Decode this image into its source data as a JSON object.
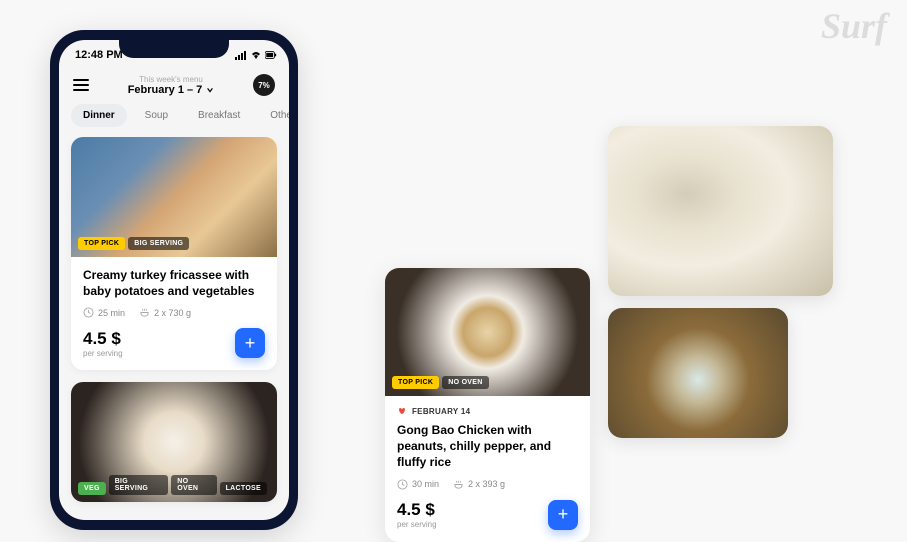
{
  "logo": "Surf",
  "phone": {
    "status_time": "12:48 PM",
    "header_sub": "This week's menu",
    "header_title": "February 1 – 7",
    "badge": "7%",
    "tabs": [
      "Dinner",
      "Soup",
      "Breakfast",
      "Other"
    ]
  },
  "cards": {
    "fricassee": {
      "pills": [
        "TOP PICK",
        "BIG SERVING"
      ],
      "title": "Creamy turkey fricassee with baby potatoes and vegetables",
      "time": "25 min",
      "weight": "2 x 730 g",
      "price": "4.5 $",
      "price_sub": "per serving"
    },
    "pasta": {
      "pills": [
        "VEG",
        "BIG SERVING",
        "NO OVEN",
        "LACTOSE"
      ]
    },
    "gongbao": {
      "pills": [
        "TOP PICK",
        "NO OVEN"
      ],
      "date": "FEBRUARY 14",
      "title": "Gong Bao Chicken with peanuts, chilly pepper, and fluffy rice",
      "time": "30 min",
      "weight": "2 x 393 g",
      "price": "4.5 $",
      "price_sub": "per serving"
    }
  }
}
